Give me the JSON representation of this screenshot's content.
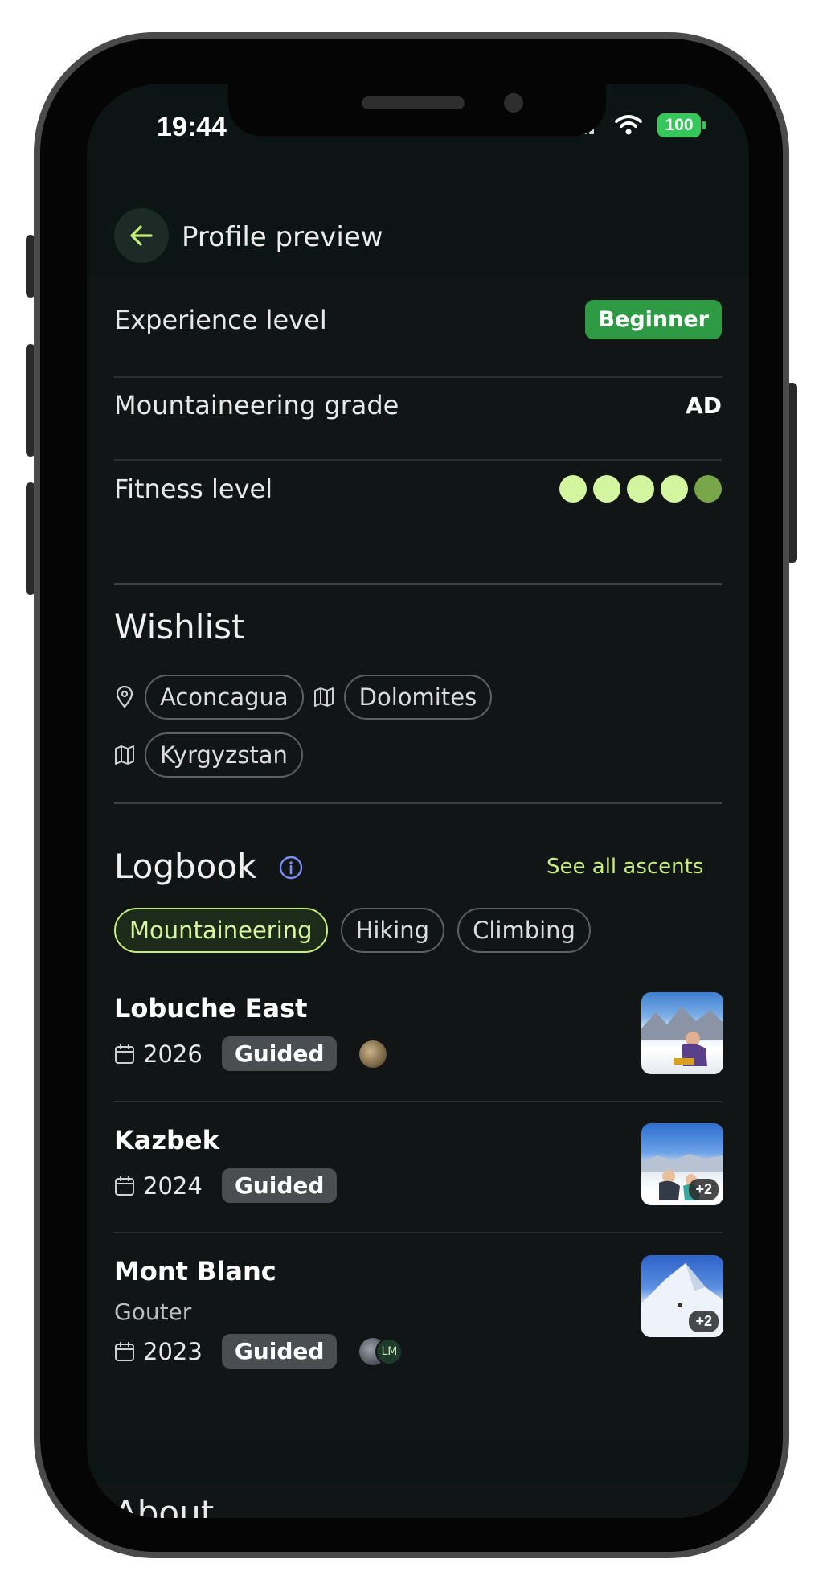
{
  "status_bar": {
    "time": "19:44",
    "battery": "100"
  },
  "header": {
    "title": "Profile preview",
    "back_icon": "arrow-left-icon"
  },
  "colors": {
    "accent_green": "#c6ee7a",
    "badge_green": "#2e9a44",
    "background": "#111516",
    "info_blue": "#7b8cff"
  },
  "details": {
    "experience_label": "Experience level",
    "experience_value": "Beginner",
    "grade_label": "Mountaineering grade",
    "grade_value": "AD",
    "fitness_label": "Fitness level",
    "fitness_value": 5,
    "fitness_max": 5
  },
  "wishlist": {
    "title": "Wishlist",
    "items": [
      {
        "label": "Aconcagua",
        "icon": "pin-icon"
      },
      {
        "label": "Dolomites",
        "icon": "map-icon"
      },
      {
        "label": "Kyrgyzstan",
        "icon": "map-icon"
      }
    ]
  },
  "logbook": {
    "title": "Logbook",
    "see_all": "See all ascents",
    "filters": [
      {
        "label": "Mountaineering",
        "active": true
      },
      {
        "label": "Hiking",
        "active": false
      },
      {
        "label": "Climbing",
        "active": false
      }
    ],
    "entries": [
      {
        "title": "Lobuche East",
        "subtitle": "",
        "year": "2026",
        "type": "Guided",
        "photo_count": ""
      },
      {
        "title": "Kazbek",
        "subtitle": "",
        "year": "2024",
        "type": "Guided",
        "photo_count": "+2"
      },
      {
        "title": "Mont Blanc",
        "subtitle": "Gouter",
        "year": "2023",
        "type": "Guided",
        "photo_count": "+2",
        "avatar_initials": "LM"
      }
    ]
  },
  "about": {
    "title": "About"
  }
}
